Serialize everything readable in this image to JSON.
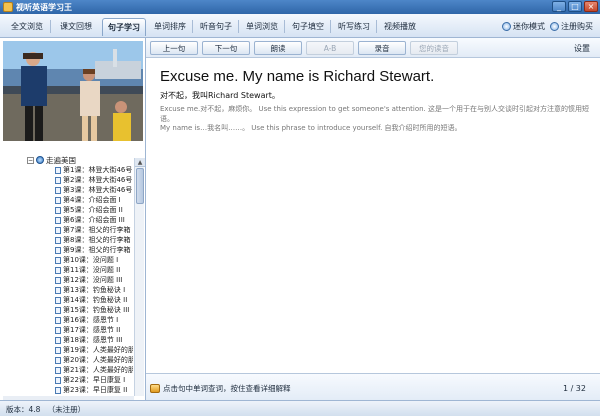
{
  "window": {
    "title": "视听英语学习王"
  },
  "tabs": [
    {
      "label": "全文浏览"
    },
    {
      "label": "课文回想"
    },
    {
      "label": "句子学习"
    },
    {
      "label": "单词排序"
    },
    {
      "label": "听音句子"
    },
    {
      "label": "单词浏览"
    },
    {
      "label": "句子填空"
    },
    {
      "label": "听写练习"
    },
    {
      "label": "视频播放"
    }
  ],
  "header_right": {
    "mini_mode": "迷你模式",
    "register": "注册购买"
  },
  "toolbar": {
    "prev": "上一句",
    "next": "下一句",
    "read": "朗读",
    "ab": "A-B",
    "record": "录音",
    "play_record": "您的读音",
    "settings": "设置"
  },
  "tree": {
    "root": "走遍美国",
    "lessons": [
      "第1课：林登大街46号 I",
      "第2课：林登大街46号 II",
      "第3课：林登大街46号 III",
      "第4课：介绍会面 I",
      "第5课：介绍会面 II",
      "第6课：介绍会面 III",
      "第7课：祖父的行李箱 I",
      "第8课：祖父的行李箱 II",
      "第9课：祖父的行李箱 III",
      "第10课：没问题 I",
      "第11课：没问题 II",
      "第12课：没问题 III",
      "第13课：钓鱼秘诀 I",
      "第14课：钓鱼秘诀 II",
      "第15课：钓鱼秘诀 III",
      "第16课：感恩节 I",
      "第17课：感恩节 II",
      "第18课：感恩节 III",
      "第19课：人类最好的朋友 I",
      "第20课：人类最好的朋友 II",
      "第21课：人类最好的朋友 III",
      "第22课：早日康复 I",
      "第23课：早日康复 II"
    ]
  },
  "content": {
    "sentence": "Excuse me. My name is Richard Stewart.",
    "translation": "对不起，我叫Richard Stewart。",
    "explanation_1": "Excuse me.对不起，麻烦你。 Use this expression to get someone's attention. 这是一个用于在与别人交谈时引起对方注意的惯用短语。",
    "explanation_2": "My name is…我名叫……。 Use this phrase to introduce yourself. 自我介绍时所用的短语。"
  },
  "status": {
    "hint": "点击句中单词查词，按住查看详细解释",
    "page": "1 / 32"
  },
  "footer": {
    "version_label": "版本：",
    "version": "4.8",
    "register_status": "（未注册）"
  }
}
